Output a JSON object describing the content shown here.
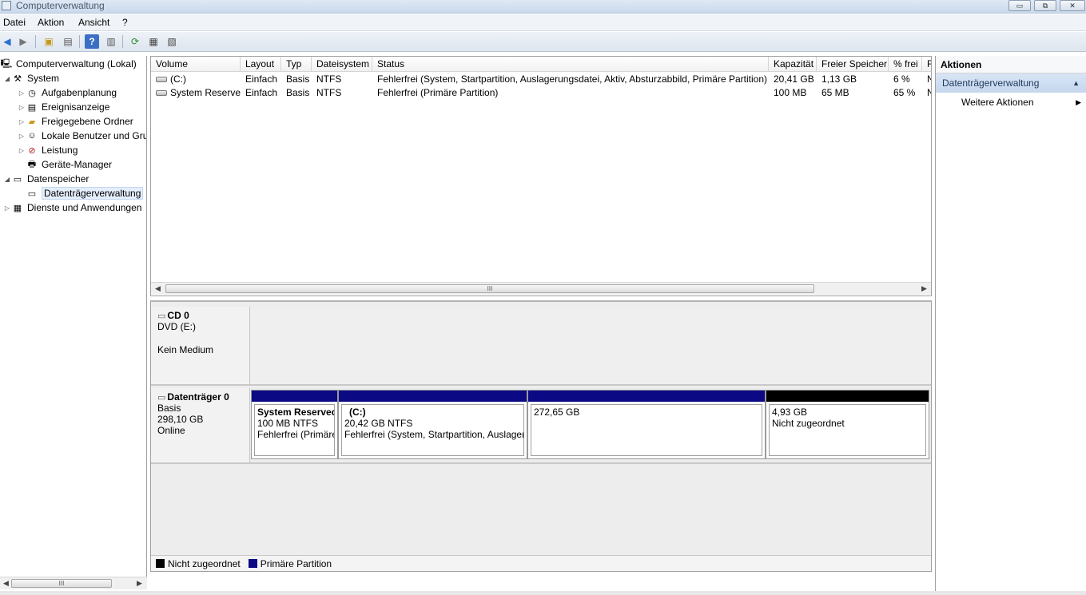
{
  "window": {
    "title": "Computerverwaltung",
    "controls": [
      "▭",
      "⧉",
      "✕"
    ]
  },
  "menu": [
    "Datei",
    "Aktion",
    "Ansicht",
    "?"
  ],
  "tree": {
    "root": "Computerverwaltung (Lokal)",
    "system": "System",
    "aufgaben": "Aufgabenplanung",
    "ereignis": "Ereignisanzeige",
    "freigegeben": "Freigegebene Ordner",
    "lokale": "Lokale Benutzer und Gruppen",
    "leistung": "Leistung",
    "geraete": "Geräte-Manager",
    "datenspeicher": "Datenspeicher",
    "datentraeger": "Datenträgerverwaltung",
    "dienste": "Dienste und Anwendungen"
  },
  "table": {
    "columns": [
      "Volume",
      "Layout",
      "Typ",
      "Dateisystem",
      "Status",
      "Kapazität",
      "Freier Speicher",
      "% frei",
      "F"
    ],
    "rows": [
      {
        "volume": "(C:)",
        "layout": "Einfach",
        "typ": "Basis",
        "fs": "NTFS",
        "status": "Fehlerfrei (System, Startpartition, Auslagerungsdatei, Aktiv, Absturzabbild, Primäre Partition)",
        "kap": "20,41 GB",
        "frei": "1,13 GB",
        "pct": "6 %",
        "f": "N"
      },
      {
        "volume": "System Reserved",
        "layout": "Einfach",
        "typ": "Basis",
        "fs": "NTFS",
        "status": "Fehlerfrei (Primäre Partition)",
        "kap": "100 MB",
        "frei": "65 MB",
        "pct": "65 %",
        "f": "N"
      }
    ],
    "scroll_thumb": "III"
  },
  "disks": {
    "cd": {
      "name": "CD 0",
      "line1": "DVD (E:)",
      "line2": "Kein Medium"
    },
    "disk0": {
      "name": "Datenträger 0",
      "line1": "Basis",
      "line2": "298,10 GB",
      "line3": "Online",
      "partitions": [
        {
          "name": "System Reserved",
          "size": "100 MB NTFS",
          "status": "Fehlerfrei (Primäre Partition)"
        },
        {
          "name": "(C:)",
          "size": "20,42 GB NTFS",
          "status": "Fehlerfrei (System, Startpartition, Auslagerungsdatei)"
        },
        {
          "name": "",
          "size": "272,65 GB",
          "status": ""
        },
        {
          "name": "",
          "size": "4,93 GB",
          "status": "Nicht zugeordnet"
        }
      ]
    }
  },
  "legend": {
    "unallocated": "Nicht zugeordnet",
    "primary": "Primäre Partition"
  },
  "colors": {
    "primary": "#0b0a84",
    "unallocated": "#000000",
    "selection": "#c5d7ee"
  },
  "actions": {
    "header": "Aktionen",
    "section": "Datenträgerverwaltung",
    "item": "Weitere Aktionen"
  },
  "tree_scroll_thumb": "III"
}
